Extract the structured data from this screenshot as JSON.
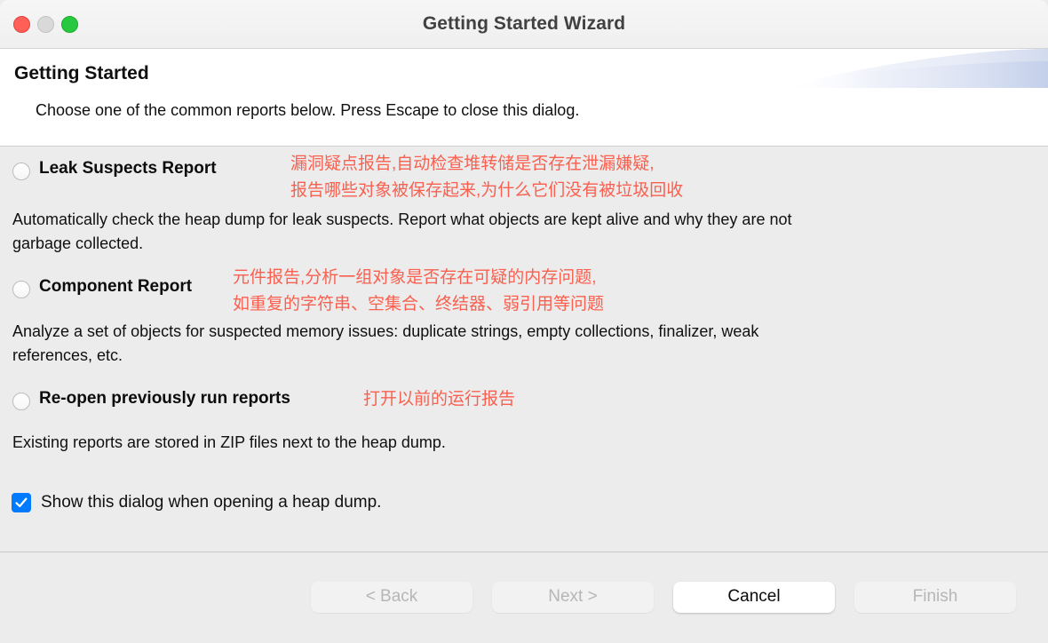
{
  "window": {
    "title": "Getting Started Wizard",
    "traffic_lights": [
      "close",
      "minimize",
      "zoom"
    ]
  },
  "header": {
    "title": "Getting Started",
    "description": "Choose one of the common reports below. Press Escape to close this dialog."
  },
  "options": [
    {
      "label": "Leak Suspects Report",
      "selected": false,
      "annotation_line1": "漏洞疑点报告,自动检查堆转储是否存在泄漏嫌疑,",
      "annotation_line2": "报告哪些对象被保存起来,为什么它们没有被垃圾回收",
      "description": "Automatically check the heap dump for leak suspects. Report what objects are kept alive and why they are not garbage collected."
    },
    {
      "label": "Component Report",
      "selected": false,
      "annotation_line1": "元件报告,分析一组对象是否存在可疑的内存问题,",
      "annotation_line2": "如重复的字符串、空集合、终结器、弱引用等问题",
      "description": "Analyze a set of objects for suspected memory issues: duplicate strings, empty collections, finalizer, weak references, etc."
    },
    {
      "label": "Re-open previously run reports",
      "selected": false,
      "annotation_line1": "打开以前的运行报告",
      "annotation_line2": "",
      "description": "Existing reports are stored in ZIP files next to the heap dump."
    }
  ],
  "checkbox": {
    "label": "Show this dialog when opening a heap dump.",
    "checked": true
  },
  "buttons": [
    {
      "label": "< Back",
      "state": "disabled"
    },
    {
      "label": "Next >",
      "state": "disabled"
    },
    {
      "label": "Cancel",
      "state": "enabled"
    },
    {
      "label": "Finish",
      "state": "disabled"
    }
  ],
  "colors": {
    "annotation_red": "#f9604f",
    "accent_blue": "#007aff",
    "close": "#ff5f57",
    "minimize": "#d9d9d9",
    "zoom": "#28c840",
    "content_bg": "#ececec"
  }
}
